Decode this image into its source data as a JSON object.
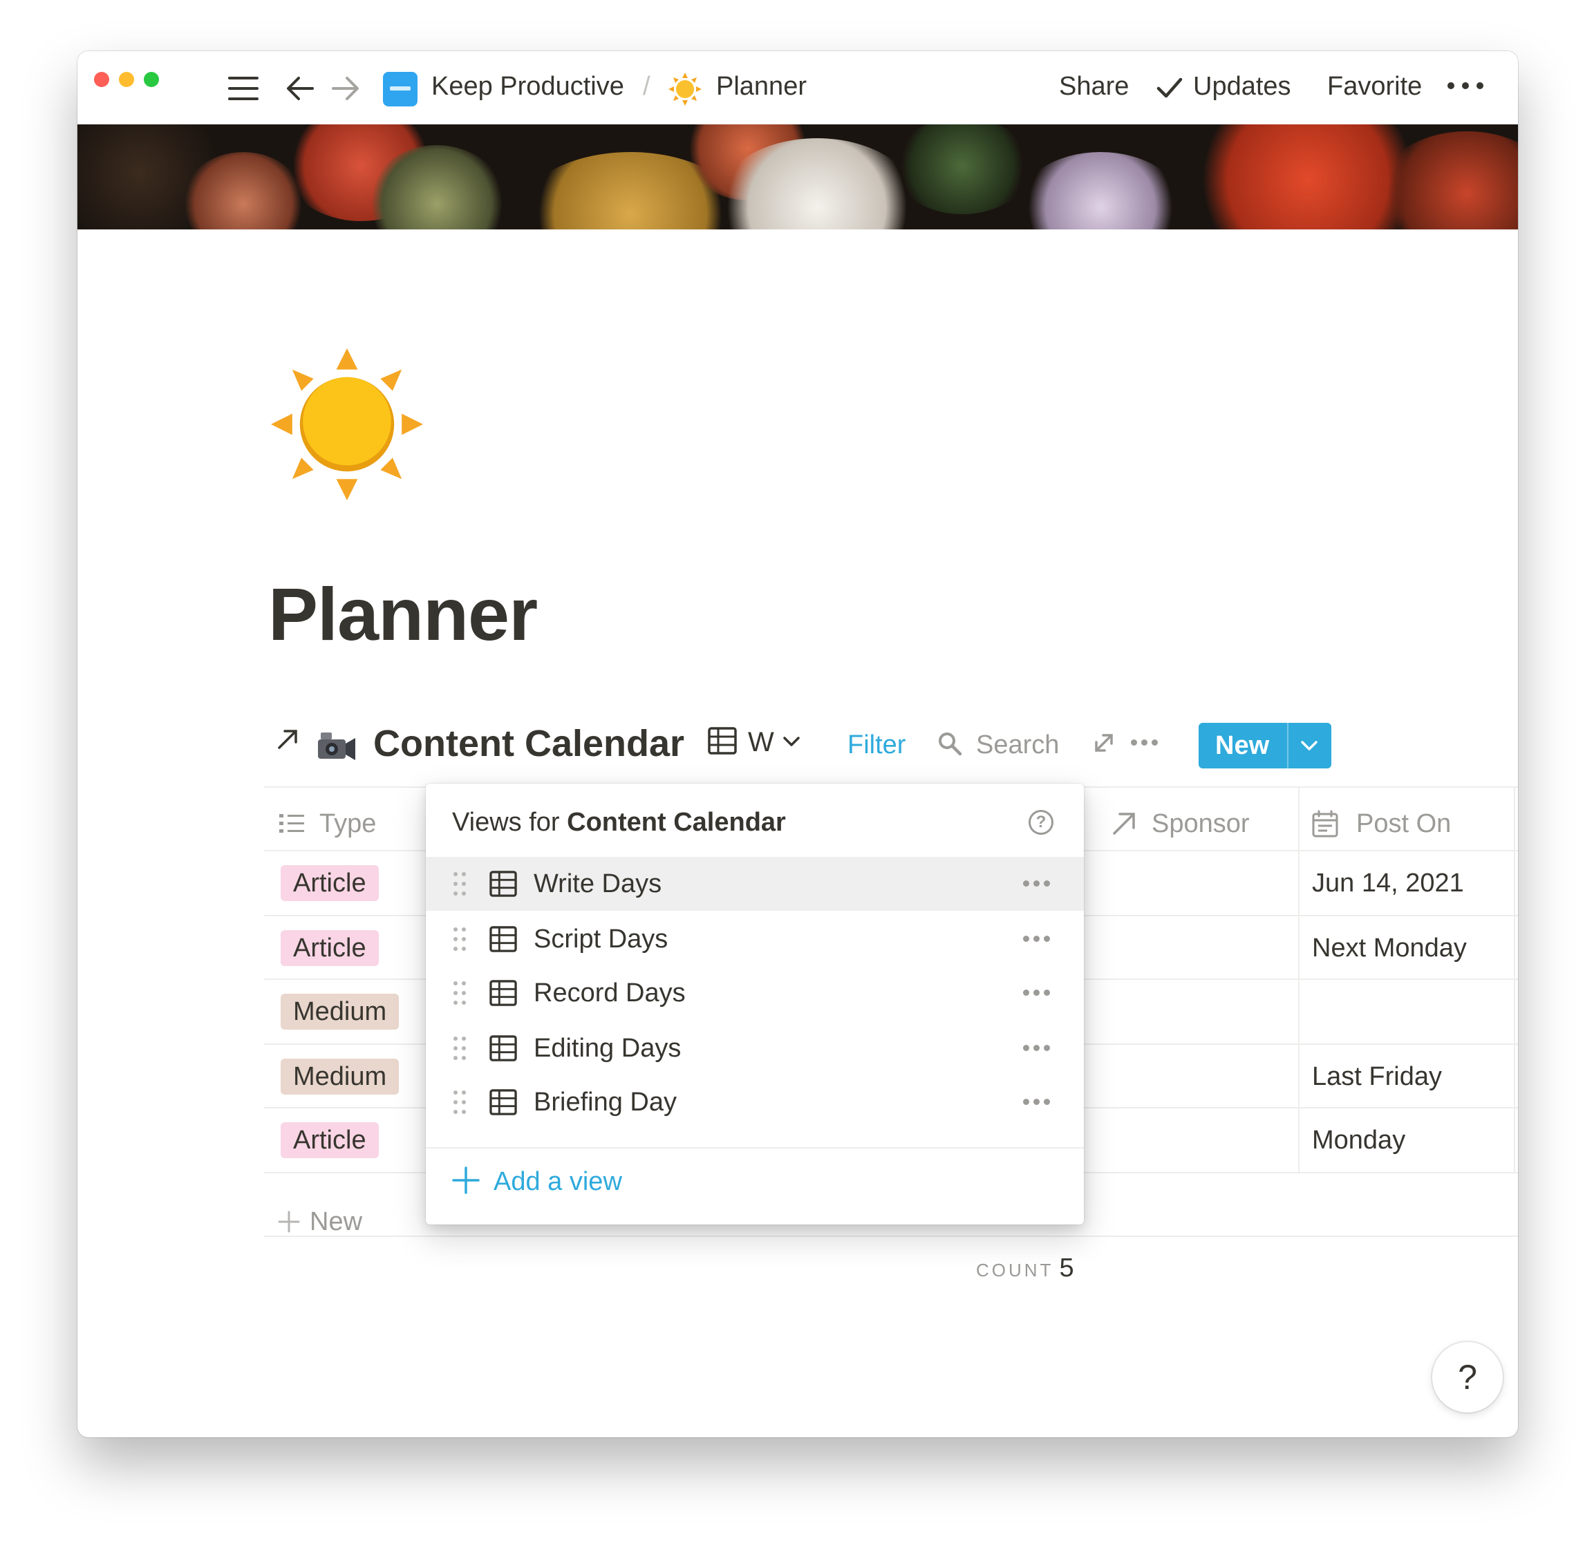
{
  "titlebar": {
    "breadcrumb_workspace": "Keep Productive",
    "breadcrumb_sep": "/",
    "breadcrumb_page": "Planner",
    "share_label": "Share",
    "updates_label": "Updates",
    "favorite_label": "Favorite"
  },
  "page": {
    "title": "Planner",
    "icon": "sun-emoji"
  },
  "database": {
    "title": "Content Calendar",
    "icon": "video-camera-emoji",
    "current_view_letter": "W",
    "filter_label": "Filter",
    "search_label": "Search",
    "new_label": "New",
    "columns": [
      {
        "label": "Type",
        "icon": "list-icon"
      },
      {
        "label": "Sponsor",
        "icon": "relation-arrow-icon"
      },
      {
        "label": "Post On",
        "icon": "calendar-icon"
      }
    ],
    "rows": [
      {
        "type": "Article",
        "post_on": "Jun 14, 2021"
      },
      {
        "type": "Article",
        "post_on": "Next Monday"
      },
      {
        "type": "Medium",
        "post_on": ""
      },
      {
        "type": "Medium",
        "post_on": "Last Friday"
      },
      {
        "type": "Article",
        "post_on": "Monday"
      }
    ],
    "add_row_label": "New",
    "count_label": "COUNT",
    "count_value": "5"
  },
  "views_popup": {
    "heading_prefix": "Views for ",
    "heading_db": "Content Calendar",
    "views": [
      {
        "label": "Write Days"
      },
      {
        "label": "Script Days"
      },
      {
        "label": "Record Days"
      },
      {
        "label": "Editing Days"
      },
      {
        "label": "Briefing Day"
      }
    ],
    "add_view_label": "Add a view"
  },
  "help_label": "?",
  "colors": {
    "accent_blue": "#2eaadc",
    "tag_pink": "#f9d5e5",
    "tag_brown": "#e9d6cc",
    "text": "#37352f",
    "muted": "#9b9a97"
  }
}
